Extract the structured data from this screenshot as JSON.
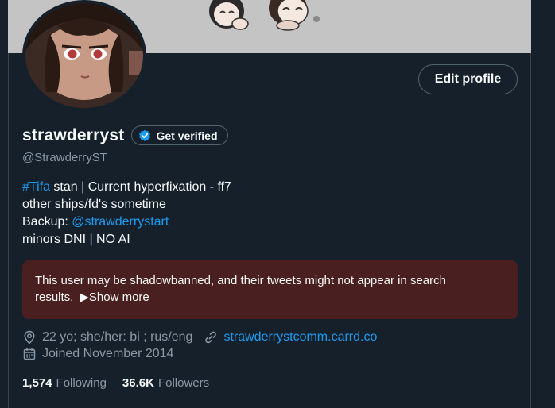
{
  "profile": {
    "display_name": "strawderryst",
    "handle": "@StrawderryST",
    "edit_profile_label": "Edit profile",
    "get_verified_label": "Get verified"
  },
  "bio": {
    "hashtag": "#Tifa",
    "line1_rest": " stan | Current hyperfixation - ff7",
    "line2": "other ships/fd's sometime",
    "line3_prefix": "Backup: ",
    "backup_mention": "@strawderrystart",
    "line4": "minors DNI | NO AI"
  },
  "warning": {
    "text": "This user may be shadowbanned, and their tweets might not appear in search results.",
    "show_more": "▶Show more"
  },
  "meta": {
    "location": "22 yo; she/her: bi ; rus/eng",
    "website": "strawderrystcomm.carrd.co",
    "joined": "Joined November 2014"
  },
  "stats": {
    "following_count": "1,574",
    "following_label": "Following",
    "followers_count": "36.6K",
    "followers_label": "Followers"
  },
  "icons": {
    "location": "location-pin-icon",
    "link": "link-icon",
    "calendar": "calendar-icon",
    "verified": "verified-badge-icon"
  },
  "colors": {
    "background": "#15202b",
    "accent": "#1d9bf0",
    "warning_bg": "#4a1f1f",
    "muted": "#8b98a5"
  }
}
